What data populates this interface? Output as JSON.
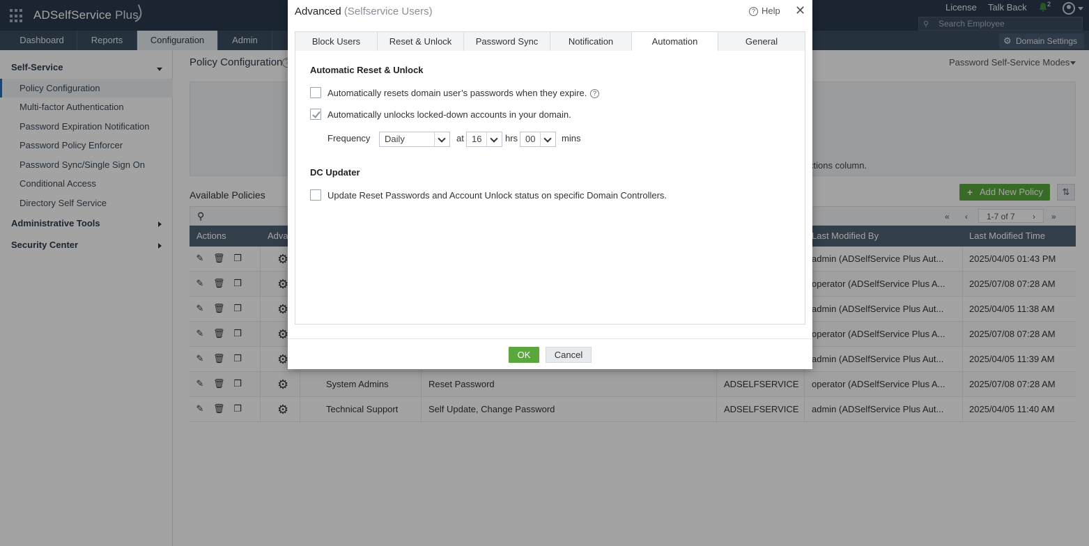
{
  "app": {
    "product_name": "ADSelfService",
    "product_suffix": "Plus"
  },
  "topbar": {
    "license": "License",
    "talk_back": "Talk Back",
    "notification_count": "2",
    "search_placeholder": "Search Employee"
  },
  "nav": {
    "tabs": [
      "Dashboard",
      "Reports",
      "Configuration",
      "Admin"
    ],
    "active_tab": "Configuration",
    "domain_settings": "Domain Settings"
  },
  "sidebar": {
    "self_service": "Self-Service",
    "items": [
      "Policy Configuration",
      "Multi-factor Authentication",
      "Password Expiration Notification",
      "Password Policy Enforcer",
      "Password Sync/Single Sign On",
      "Conditional Access",
      "Directory Self Service"
    ],
    "active_item": "Policy Configuration",
    "administrative_tools": "Administrative Tools",
    "security_center": "Security Center"
  },
  "main": {
    "page_title": "Policy Configuration",
    "modes_label": "Password Self-Service Modes",
    "info_text_fragment": "ctions column.",
    "available_policies": "Available Policies",
    "add_new_policy": "Add New Policy",
    "pagination": "1-7 of 7",
    "columns": {
      "actions": "Actions",
      "advanced": "Adva",
      "last_modified_by": "Last Modified By",
      "last_modified_time": "Last Modified Time"
    },
    "rows": [
      {
        "name": "",
        "features": "",
        "domain": "",
        "modified_by": "admin (ADSelfService Plus Aut...",
        "modified_time": "2025/04/05 01:43 PM"
      },
      {
        "name": "",
        "features": "",
        "domain": "",
        "modified_by": "operator (ADSelfService Plus A...",
        "modified_time": "2025/07/08 07:28 AM"
      },
      {
        "name": "",
        "features": "",
        "domain": "",
        "modified_by": "admin (ADSelfService Plus Aut...",
        "modified_time": "2025/04/05 11:38 AM"
      },
      {
        "name": "",
        "features": "",
        "domain": "",
        "modified_by": "operator (ADSelfService Plus A...",
        "modified_time": "2025/07/08 07:28 AM"
      },
      {
        "name": "",
        "features": "",
        "domain": "",
        "modified_by": "admin (ADSelfService Plus Aut...",
        "modified_time": "2025/04/05 11:39 AM"
      },
      {
        "name": "System Admins",
        "features": "Reset Password",
        "domain": "ADSELFSERVICE",
        "modified_by": "operator (ADSelfService Plus A...",
        "modified_time": "2025/07/08 07:28 AM"
      },
      {
        "name": "Technical Support",
        "features": "Self Update, Change Password",
        "domain": "ADSELFSERVICE",
        "modified_by": "admin (ADSelfService Plus Aut...",
        "modified_time": "2025/04/05 11:40 AM"
      }
    ]
  },
  "dialog": {
    "title": "Advanced",
    "subtitle": "(Selfservice Users)",
    "help": "Help",
    "tabs": [
      "Block Users",
      "Reset & Unlock",
      "Password Sync",
      "Notification",
      "Automation",
      "General"
    ],
    "active_tab": "Automation",
    "section1_title": "Automatic Reset & Unlock",
    "auto_reset_label": "Automatically resets domain user’s passwords when they expire.",
    "auto_reset_checked": false,
    "auto_unlock_label": "Automatically unlocks locked-down accounts in your domain.",
    "auto_unlock_checked": true,
    "frequency_label": "Frequency",
    "frequency_value": "Daily",
    "at_label": "at",
    "hours_value": "16",
    "hrs_label": "hrs",
    "minutes_value": "00",
    "mins_label": "mins",
    "section2_title": "DC Updater",
    "dc_update_label": "Update Reset Passwords and Account Unlock status on specific Domain Controllers.",
    "dc_update_checked": false,
    "ok": "OK",
    "cancel": "Cancel"
  }
}
